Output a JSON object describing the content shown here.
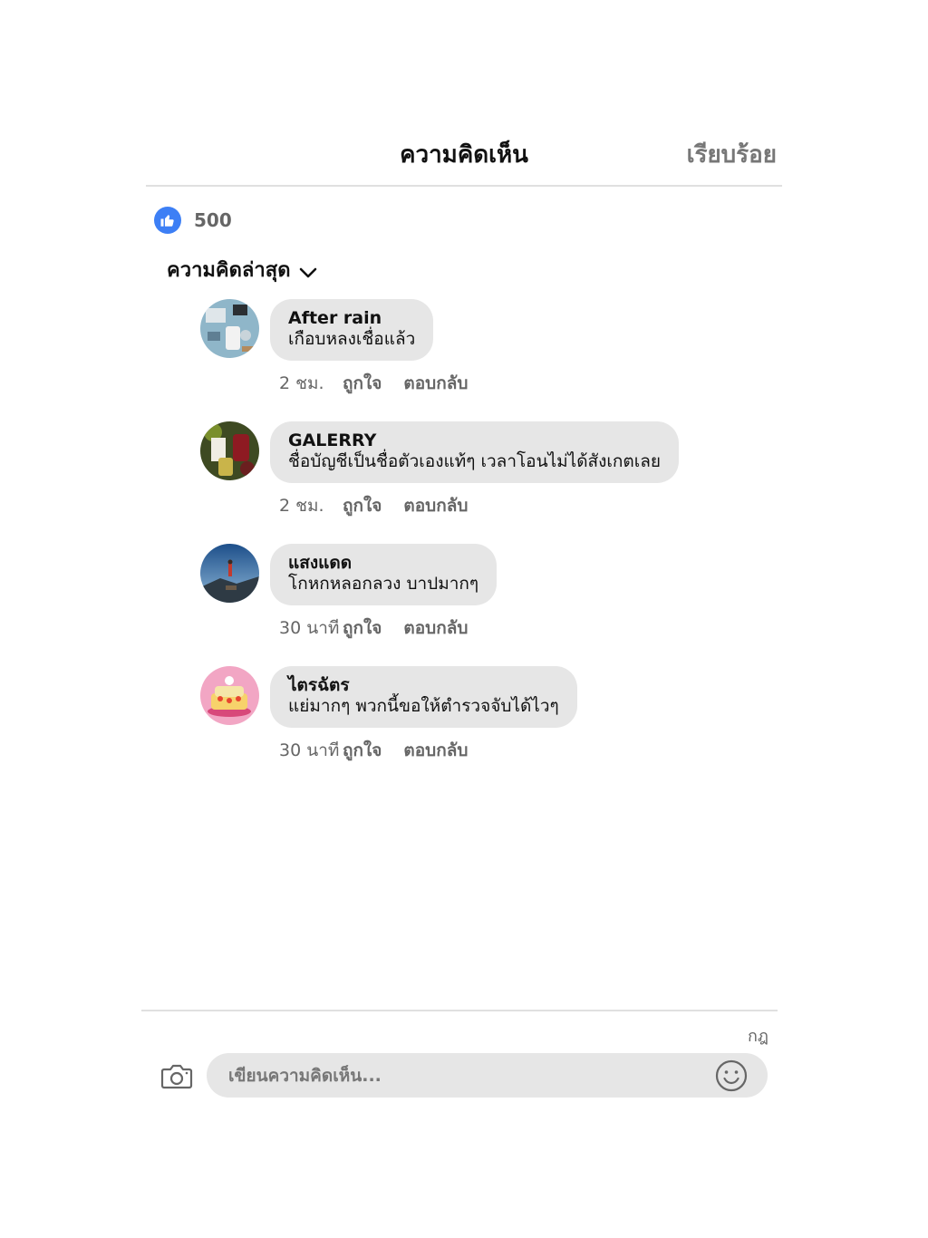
{
  "header": {
    "title": "ความคิดเห็น",
    "done_label": "เรียบร้อย"
  },
  "likes": {
    "count": "500",
    "color": "#3d7ff5"
  },
  "sort": {
    "label": "ความคิดล่าสุด"
  },
  "comments": [
    {
      "author": "After rain",
      "text": "เกือบหลงเชื่อแล้ว",
      "time": "2 ชม.",
      "like_label": "ถูกใจ",
      "reply_label": "ตอบกลับ"
    },
    {
      "author": "GALERRY",
      "text": "ชื่อบัญชีเป็นชื่อตัวเองแท้ๆ เวลาโอนไม่ได้สังเกตเลย",
      "time": "2 ชม.",
      "like_label": "ถูกใจ",
      "reply_label": "ตอบกลับ"
    },
    {
      "author": "แสงแดด",
      "text": "โกหกหลอกลวง บาปมากๆ",
      "time": "30 นาที",
      "like_label": "ถูกใจ",
      "reply_label": "ตอบกลับ"
    },
    {
      "author": "ไตรฉัตร",
      "text": "แย่มากๆ พวกนี้ขอให้ตำรวจจับได้ไวๆ",
      "time": "30 นาที",
      "like_label": "ถูกใจ",
      "reply_label": "ตอบกลับ"
    }
  ],
  "composer": {
    "placeholder": "เขียนความคิดเห็น...",
    "char_label": "กฎ",
    "camera_icon": "camera-icon",
    "emoji_icon": "emoji-icon"
  }
}
